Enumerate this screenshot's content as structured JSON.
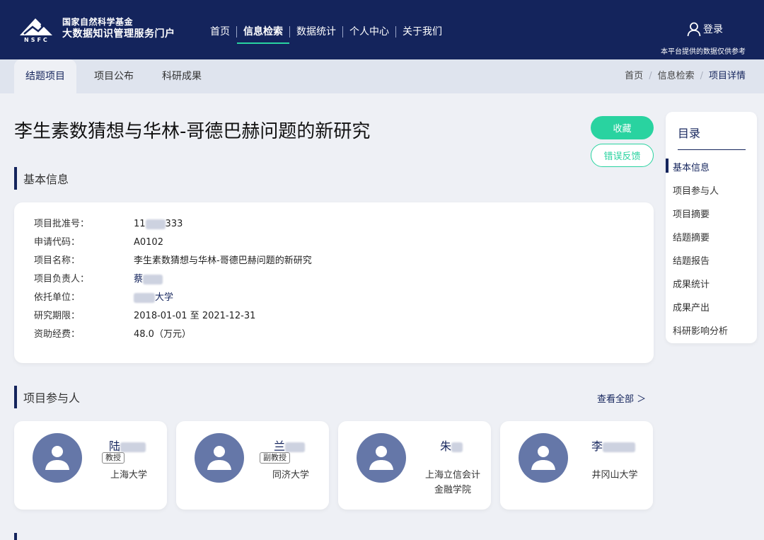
{
  "header": {
    "logo_line1": "国家自然科学基金",
    "logo_line2": "大数据知识管理服务门户",
    "logo_badge": "NSFC",
    "nav": [
      "首页",
      "信息检索",
      "数据统计",
      "个人中心",
      "关于我们"
    ],
    "active_nav": "信息检索",
    "login_label": "登录",
    "disclaimer": "本平台提供的数据仅供参考",
    "icons": [
      "user-icon"
    ]
  },
  "subnav": {
    "tabs": [
      "结题项目",
      "项目公布",
      "科研成果"
    ],
    "active_tab": "结题项目",
    "breadcrumb": [
      "首页",
      "信息检索",
      "项目详情"
    ],
    "breadcrumb_sep": "/"
  },
  "project": {
    "title": "李生素数猜想与华林-哥德巴赫问题的新研究",
    "collect_label": "收藏",
    "feedback_label": "错误反馈"
  },
  "basic_info": {
    "section_title": "基本信息",
    "rows": [
      {
        "label": "项目批准号：",
        "value_prefix": "11",
        "value_suffix": "333"
      },
      {
        "label": "申请代码：",
        "value": "A0102"
      },
      {
        "label": "项目名称：",
        "value": "李生素数猜想与华林-哥德巴赫问题的新研究"
      },
      {
        "label": "项目负责人：",
        "value_prefix": "蔡"
      },
      {
        "label": "依托单位：",
        "value_suffix": "大学"
      },
      {
        "label": "研究期限：",
        "value": "2018-01-01 至 2021-12-31"
      },
      {
        "label": "资助经费：",
        "value": "48.0（万元）"
      }
    ]
  },
  "participants": {
    "section_title": "项目参与人",
    "view_all": "查看全部 ＞",
    "people": [
      {
        "name": "陆",
        "rank": "教授",
        "org": "上海大学"
      },
      {
        "name": "兰",
        "rank": "副教授",
        "org": "同济大学"
      },
      {
        "name": "朱",
        "rank": "",
        "org_line1": "上海立信会计",
        "org_line2": "金融学院"
      },
      {
        "name": "李",
        "rank": "",
        "org": "井冈山大学"
      }
    ]
  },
  "toc": {
    "title": "目录",
    "items": [
      "基本信息",
      "项目参与人",
      "项目摘要",
      "结题摘要",
      "结题报告",
      "成果统计",
      "成果产出",
      "科研影响分析"
    ],
    "active": "基本信息"
  },
  "colors": {
    "brand": "#14245c",
    "accent": "#29d3a0",
    "avatar": "#6577a8"
  }
}
